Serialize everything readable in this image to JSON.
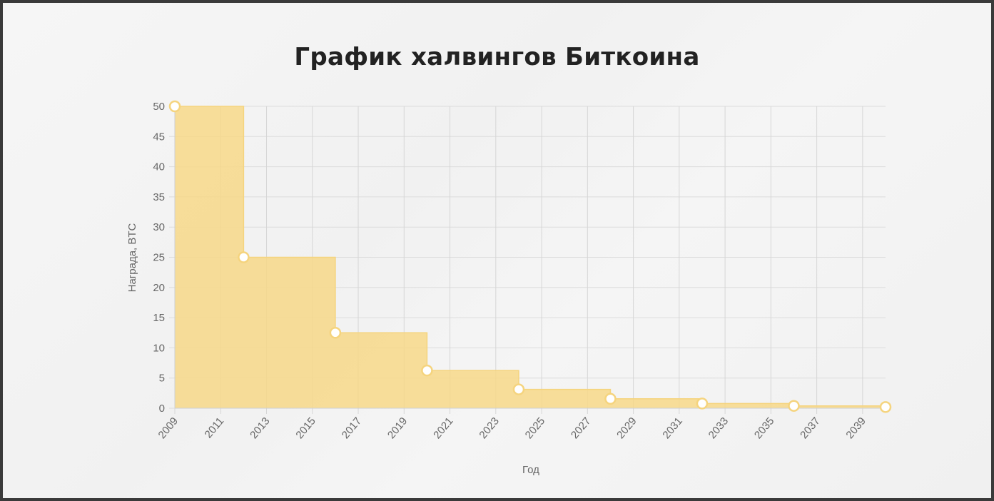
{
  "page": {
    "title": "График халвингов Биткоина"
  },
  "chart_data": {
    "type": "area",
    "step": "after",
    "title": "График халвингов Биткоина",
    "xlabel": "Год",
    "ylabel": "Награда, BTC",
    "xlim": [
      2009,
      2040
    ],
    "ylim": [
      0,
      50
    ],
    "grid": true,
    "legend": "none",
    "x_ticks": [
      2009,
      2011,
      2013,
      2015,
      2017,
      2019,
      2021,
      2023,
      2025,
      2027,
      2029,
      2031,
      2033,
      2035,
      2037,
      2039
    ],
    "y_ticks": [
      0,
      5,
      10,
      15,
      20,
      25,
      30,
      35,
      40,
      45,
      50
    ],
    "series": [
      {
        "name": "Награда, BTC",
        "color": "#f5d47e",
        "fill_color": "#f7d888",
        "point_fill": "#ffffff",
        "points": [
          {
            "x": 2009,
            "y": 50
          },
          {
            "x": 2012,
            "y": 25
          },
          {
            "x": 2016,
            "y": 12.5
          },
          {
            "x": 2020,
            "y": 6.25
          },
          {
            "x": 2024,
            "y": 3.125
          },
          {
            "x": 2028,
            "y": 1.5625
          },
          {
            "x": 2032,
            "y": 0.78125
          },
          {
            "x": 2036,
            "y": 0.390625
          },
          {
            "x": 2040,
            "y": 0.1953125
          }
        ]
      }
    ]
  }
}
